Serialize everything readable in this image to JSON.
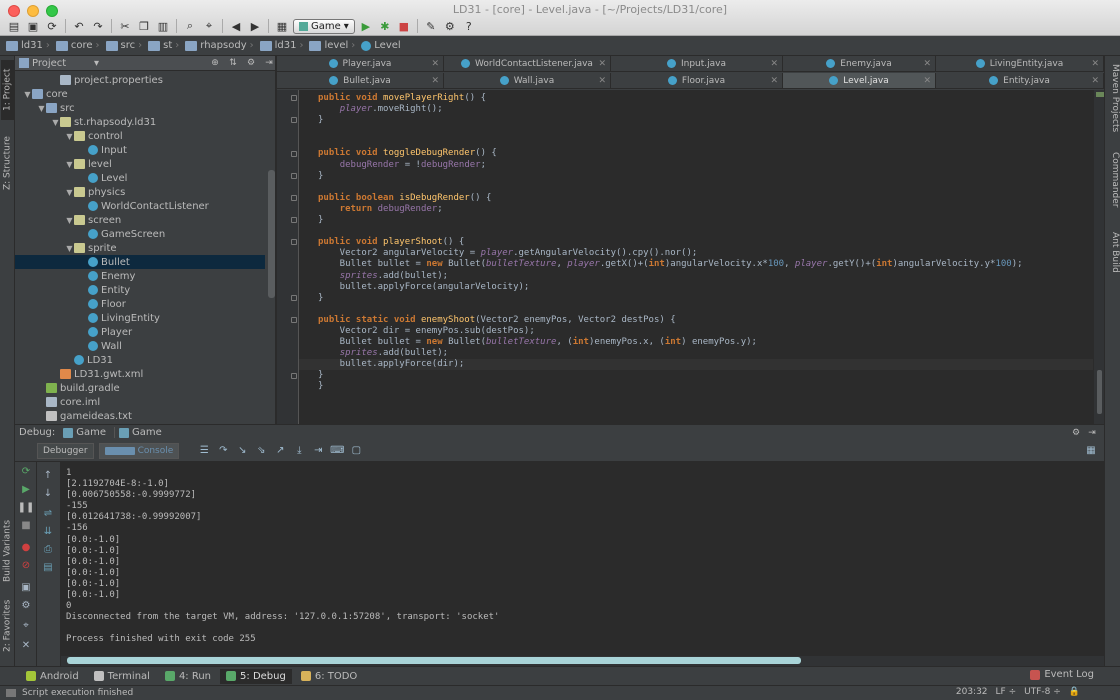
{
  "window": {
    "title": "LD31 - [core] - Level.java - [~/Projects/LD31/core]"
  },
  "toolbar": {
    "run_config": "Game"
  },
  "breadcrumb": [
    "ld31",
    "core",
    "src",
    "st",
    "rhapsody",
    "ld31",
    "level",
    "Level"
  ],
  "project_panel": {
    "title": "Project"
  },
  "tree": [
    {
      "label": "project.properties",
      "depth": 3,
      "icon": "file",
      "arrow": ""
    },
    {
      "label": "core",
      "depth": 1,
      "icon": "folder",
      "arrow": "▼"
    },
    {
      "label": "src",
      "depth": 2,
      "icon": "folder",
      "arrow": "▼"
    },
    {
      "label": "st.rhapsody.ld31",
      "depth": 3,
      "icon": "pkg",
      "arrow": "▼"
    },
    {
      "label": "control",
      "depth": 4,
      "icon": "pkg",
      "arrow": "▼"
    },
    {
      "label": "Input",
      "depth": 5,
      "icon": "cls",
      "arrow": ""
    },
    {
      "label": "level",
      "depth": 4,
      "icon": "pkg",
      "arrow": "▼"
    },
    {
      "label": "Level",
      "depth": 5,
      "icon": "cls",
      "arrow": ""
    },
    {
      "label": "physics",
      "depth": 4,
      "icon": "pkg",
      "arrow": "▼"
    },
    {
      "label": "WorldContactListener",
      "depth": 5,
      "icon": "cls",
      "arrow": ""
    },
    {
      "label": "screen",
      "depth": 4,
      "icon": "pkg",
      "arrow": "▼"
    },
    {
      "label": "GameScreen",
      "depth": 5,
      "icon": "cls",
      "arrow": ""
    },
    {
      "label": "sprite",
      "depth": 4,
      "icon": "pkg",
      "arrow": "▼"
    },
    {
      "label": "Bullet",
      "depth": 5,
      "icon": "cls",
      "arrow": "",
      "selected": true
    },
    {
      "label": "Enemy",
      "depth": 5,
      "icon": "cls",
      "arrow": ""
    },
    {
      "label": "Entity",
      "depth": 5,
      "icon": "cls",
      "arrow": ""
    },
    {
      "label": "Floor",
      "depth": 5,
      "icon": "cls",
      "arrow": ""
    },
    {
      "label": "LivingEntity",
      "depth": 5,
      "icon": "cls",
      "arrow": ""
    },
    {
      "label": "Player",
      "depth": 5,
      "icon": "cls",
      "arrow": ""
    },
    {
      "label": "Wall",
      "depth": 5,
      "icon": "cls",
      "arrow": ""
    },
    {
      "label": "LD31",
      "depth": 4,
      "icon": "cls",
      "arrow": ""
    },
    {
      "label": "LD31.gwt.xml",
      "depth": 3,
      "icon": "xml",
      "arrow": ""
    },
    {
      "label": "build.gradle",
      "depth": 2,
      "icon": "gradle",
      "arrow": ""
    },
    {
      "label": "core.iml",
      "depth": 2,
      "icon": "file",
      "arrow": ""
    },
    {
      "label": "gameideas.txt",
      "depth": 2,
      "icon": "txt",
      "arrow": ""
    }
  ],
  "tabs_row1": [
    "Player.java",
    "WorldContactListener.java",
    "Input.java",
    "Enemy.java",
    "LivingEntity.java"
  ],
  "tabs_row2": [
    "Bullet.java",
    "Wall.java",
    "Floor.java",
    "Level.java",
    "Entity.java"
  ],
  "active_tab": "Level.java",
  "code": [
    [
      [
        "kw",
        "public void "
      ],
      [
        "fn",
        "movePlayerRight"
      ],
      [
        "",
        "() {"
      ]
    ],
    [
      [
        "",
        "    "
      ],
      [
        "fdi",
        "player"
      ],
      [
        "",
        ".moveRight();"
      ]
    ],
    [
      [
        "",
        "}"
      ]
    ],
    [
      [
        "",
        ""
      ]
    ],
    [
      [
        "",
        ""
      ]
    ],
    [
      [
        "kw",
        "public void "
      ],
      [
        "fn",
        "toggleDebugRender"
      ],
      [
        "",
        "() {"
      ]
    ],
    [
      [
        "",
        "    "
      ],
      [
        "fd",
        "debugRender"
      ],
      [
        "",
        " = !"
      ],
      [
        "fd",
        "debugRender"
      ],
      [
        "",
        ";"
      ]
    ],
    [
      [
        "",
        "}"
      ]
    ],
    [
      [
        "",
        ""
      ]
    ],
    [
      [
        "kw",
        "public boolean "
      ],
      [
        "fn",
        "isDebugRender"
      ],
      [
        "",
        "() {"
      ]
    ],
    [
      [
        "kw",
        "    return "
      ],
      [
        "fd",
        "debugRender"
      ],
      [
        "",
        ";"
      ]
    ],
    [
      [
        "",
        "}"
      ]
    ],
    [
      [
        "",
        ""
      ]
    ],
    [
      [
        "kw",
        "public void "
      ],
      [
        "fn",
        "playerShoot"
      ],
      [
        "",
        "() {"
      ]
    ],
    [
      [
        "",
        "    Vector2 angularVelocity = "
      ],
      [
        "fdi",
        "player"
      ],
      [
        "",
        ".getAngularVelocity().cpy().nor();"
      ]
    ],
    [
      [
        "",
        "    Bullet bullet = "
      ],
      [
        "kw",
        "new "
      ],
      [
        "",
        "Bullet("
      ],
      [
        "fdi",
        "bulletTexture"
      ],
      [
        "",
        ", "
      ],
      [
        "fdi",
        "player"
      ],
      [
        "",
        ".getX()+("
      ],
      [
        "kw",
        "int"
      ],
      [
        "",
        ")angularVelocity.x*"
      ],
      [
        "num",
        "100"
      ],
      [
        "",
        ", "
      ],
      [
        "fdi",
        "player"
      ],
      [
        "",
        ".getY()+("
      ],
      [
        "kw",
        "int"
      ],
      [
        "",
        ")angularVelocity.y*"
      ],
      [
        "num",
        "100"
      ],
      [
        "",
        ");"
      ]
    ],
    [
      [
        "",
        "    "
      ],
      [
        "fdi",
        "sprites"
      ],
      [
        "",
        ".add(bullet);"
      ]
    ],
    [
      [
        "",
        "    bullet.applyForce(angularVelocity);"
      ]
    ],
    [
      [
        "",
        "}"
      ]
    ],
    [
      [
        "",
        ""
      ]
    ],
    [
      [
        "kw",
        "public static void "
      ],
      [
        "fn",
        "enemyShoot"
      ],
      [
        "",
        "(Vector2 enemyPos, Vector2 destPos) {"
      ]
    ],
    [
      [
        "",
        "    Vector2 dir = enemyPos.sub(destPos);"
      ]
    ],
    [
      [
        "",
        "    Bullet bullet = "
      ],
      [
        "kw",
        "new "
      ],
      [
        "",
        "Bullet("
      ],
      [
        "fdi",
        "bulletTexture"
      ],
      [
        "",
        ", ("
      ],
      [
        "kw",
        "int"
      ],
      [
        "",
        ")enemyPos.x, ("
      ],
      [
        "kw",
        "int"
      ],
      [
        "",
        ") enemyPos.y);"
      ]
    ],
    [
      [
        "",
        "    "
      ],
      [
        "fdi",
        "sprites"
      ],
      [
        "",
        ".add(bullet);"
      ]
    ],
    [
      [
        "",
        "    bullet.applyForce(dir);"
      ]
    ],
    [
      [
        "",
        "}"
      ]
    ],
    [
      [
        "",
        "}"
      ]
    ]
  ],
  "debug": {
    "label": "Debug:",
    "tabs": [
      "Game",
      "Game"
    ],
    "subtabs": [
      "Debugger",
      "Console"
    ]
  },
  "console_lines": [
    "1",
    "[2.1192704E-8:-1.0]",
    "[0.006750558:-0.9999772]",
    "-155",
    "[0.012641738:-0.99992007]",
    "-156",
    "[0.0:-1.0]",
    "[0.0:-1.0]",
    "[0.0:-1.0]",
    "[0.0:-1.0]",
    "[0.0:-1.0]",
    "[0.0:-1.0]",
    "0",
    "Disconnected from the target VM, address: '127.0.0.1:57208', transport: 'socket'",
    "",
    "Process finished with exit code 255"
  ],
  "tool_windows": [
    {
      "label": "Android",
      "color": "#a4c639"
    },
    {
      "label": "Terminal",
      "color": "#c0c0c0"
    },
    {
      "label": "4: Run",
      "color": "#59a869"
    },
    {
      "label": "5: Debug",
      "color": "#59a869",
      "active": true
    },
    {
      "label": "6: TODO",
      "color": "#d8b25a"
    }
  ],
  "event_log": "Event Log",
  "status": {
    "message": "Script execution finished",
    "position": "203:32",
    "line_sep": "LF ÷",
    "encoding": "UTF-8 ÷"
  },
  "side_tabs_left": [
    "1: Project",
    "Z: Structure",
    "Build Variants",
    "2: Favorites"
  ],
  "side_tabs_right": [
    "Maven Projects",
    "Commander",
    "Ant Build"
  ]
}
